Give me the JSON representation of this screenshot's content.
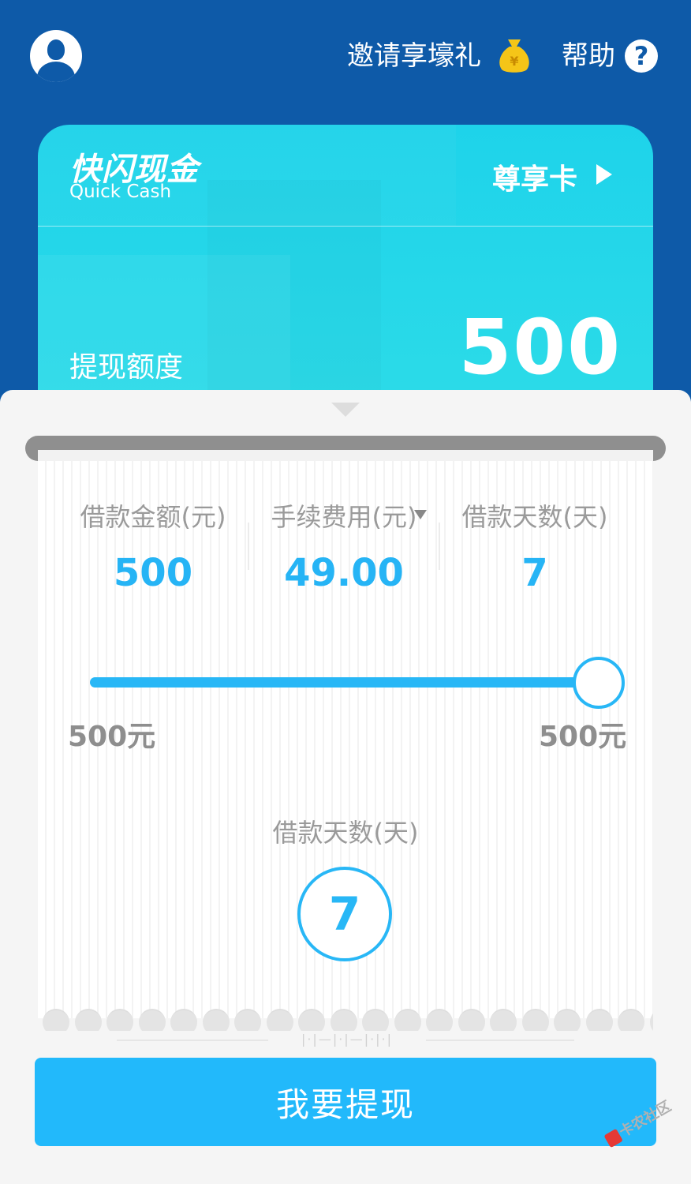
{
  "header": {
    "invite_label": "邀请享壕礼",
    "help_label": "帮助",
    "help_symbol": "?",
    "colors": {
      "background": "#0e5aa8",
      "coin_bag": "#f5c518"
    }
  },
  "card": {
    "logo_cn": "快闪现金",
    "logo_en": "Quick Cash",
    "vip_label": "尊享卡",
    "quota_label": "提现额度",
    "quota_value": "500",
    "colors": {
      "card_gradient_top": "#1ed3ea",
      "card_gradient_bottom": "#2cdbe8"
    }
  },
  "summary": {
    "amount_label": "借款金额(元)",
    "amount_value": "500",
    "fee_label": "手续费用(元)",
    "fee_value": "49.00",
    "days_label": "借款天数(天)",
    "days_value": "7"
  },
  "slider": {
    "min_label": "500元",
    "max_label": "500元",
    "fraction": 1.0,
    "accent_color": "#28b7f6"
  },
  "days_picker": {
    "label": "借款天数(天)",
    "value": "7"
  },
  "submit_label": "我要提现",
  "watermark_text": "卡农社区"
}
